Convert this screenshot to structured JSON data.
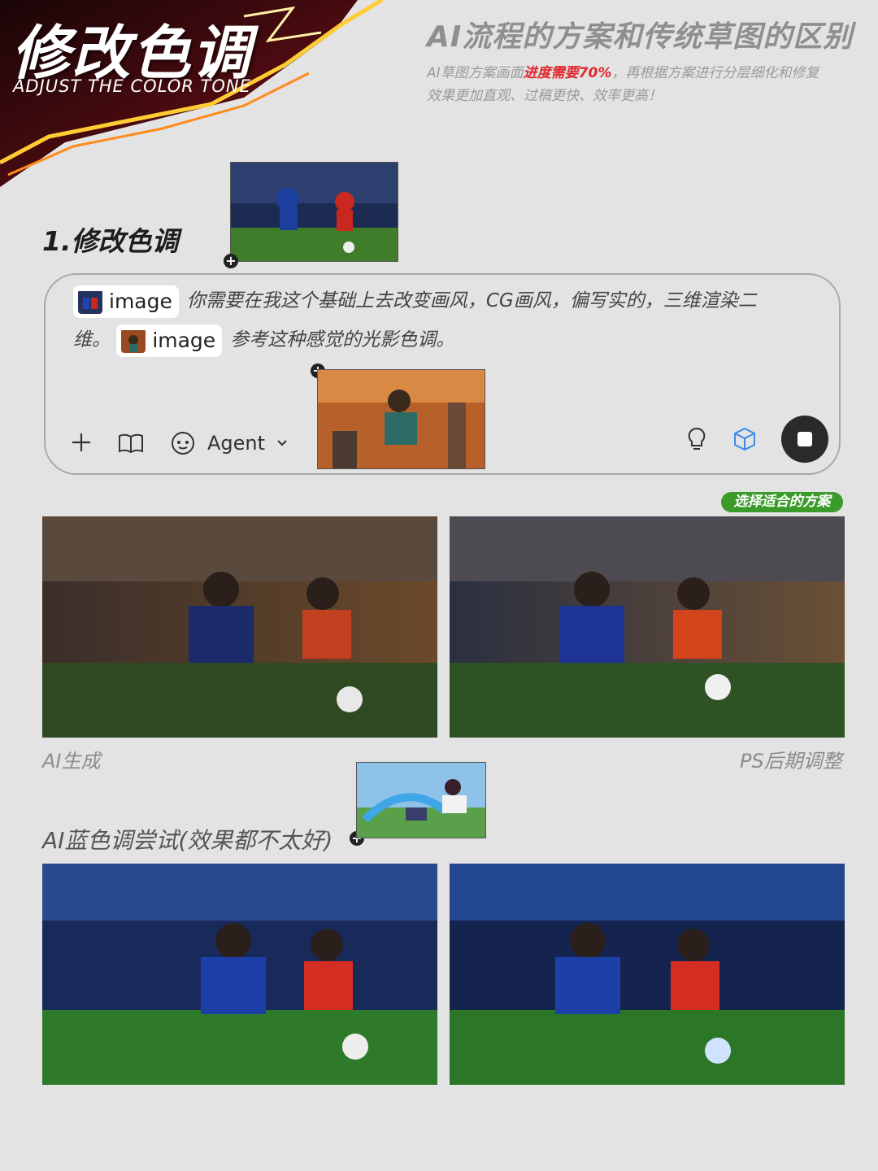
{
  "header": {
    "title": "修改色调",
    "subtitle": "ADJUST THE COLOR TONE",
    "right_title": "AI流程的方案和传统草图的区别",
    "right_desc_1_pre": "AI草图方案画面",
    "right_desc_1_highlight": "进度需要70%",
    "right_desc_1_post": "，再根据方案进行分层细化和修复",
    "right_desc_2": "效果更加直观、过稿更快、效率更高！"
  },
  "section1": {
    "title": "1.修改色调"
  },
  "prompt": {
    "chip_label": "image",
    "text_1": "你需要在我这个基础上去改变画风，CG画风，偏写实的，三维渲染二",
    "text_2_pre": "维。",
    "chip2_label": "image",
    "text_2_post": "参考这种感觉的光影色调。",
    "toolbar": {
      "add_icon": "plus-icon",
      "book_icon": "book-icon",
      "agent_label": "Agent",
      "bulb_icon": "lightbulb-icon",
      "cube_icon": "cube-icon",
      "stop_icon": "stop-icon"
    }
  },
  "badge": "选择适合的方案",
  "captions": {
    "left": "AI生成",
    "right": "PS后期调整"
  },
  "section2": {
    "title": "AI蓝色调尝试(效果都不太好)"
  },
  "colors": {
    "accent_green": "#3a9b2a",
    "highlight_red": "#e0262b",
    "background": "#e3e3e3"
  }
}
